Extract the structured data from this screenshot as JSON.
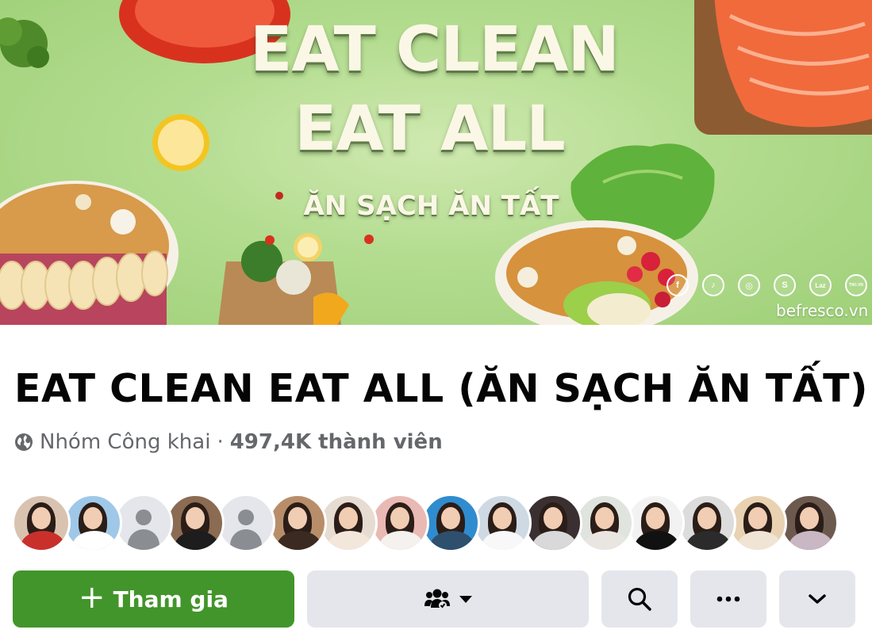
{
  "cover": {
    "title_line1": "EAT CLEAN",
    "title_line2": "EAT ALL",
    "subtitle": "ĂN SẠCH ĂN TẤT",
    "social_icons": [
      {
        "name": "facebook-icon",
        "glyph": "f"
      },
      {
        "name": "tiktok-icon",
        "glyph": "♪"
      },
      {
        "name": "instagram-icon",
        "glyph": "◎"
      },
      {
        "name": "shopee-icon",
        "glyph": "S"
      },
      {
        "name": "lazada-icon",
        "glyph": "Laz"
      },
      {
        "name": "tiki-icon",
        "glyph": "TIKI.VN"
      }
    ],
    "website": "befresco.vn"
  },
  "group": {
    "name": "EAT CLEAN EAT ALL (ĂN SẠCH ĂN TẤT)",
    "privacy": "Nhóm Công khai",
    "separator": "·",
    "members": "497,4K thành viên"
  },
  "avatars": [
    {
      "kind": "photo",
      "bg": "#d9c3b0",
      "shirt": "#c9302c"
    },
    {
      "kind": "photo",
      "bg": "#9fc8e8",
      "shirt": "#ffffff"
    },
    {
      "kind": "placeholder"
    },
    {
      "kind": "photo",
      "bg": "#8b6b52",
      "shirt": "#1d1d1d"
    },
    {
      "kind": "placeholder"
    },
    {
      "kind": "photo",
      "bg": "#b88e6a",
      "shirt": "#3b2a22"
    },
    {
      "kind": "photo",
      "bg": "#e6dcd2",
      "shirt": "#f3e7dc"
    },
    {
      "kind": "photo",
      "bg": "#e9b9b4",
      "shirt": "#f4f1ef"
    },
    {
      "kind": "photo",
      "bg": "#2f8ccf",
      "shirt": "#2e4f6e"
    },
    {
      "kind": "photo",
      "bg": "#cfd9e3",
      "shirt": "#f8f8f8"
    },
    {
      "kind": "photo",
      "bg": "#3a3032",
      "shirt": "#d9d9d9"
    },
    {
      "kind": "photo",
      "bg": "#dfe4de",
      "shirt": "#e9e6e2"
    },
    {
      "kind": "photo",
      "bg": "#f2f2f2",
      "shirt": "#111111"
    },
    {
      "kind": "photo",
      "bg": "#dcdcdc",
      "shirt": "#2b2b2b"
    },
    {
      "kind": "photo",
      "bg": "#e8d2b2",
      "shirt": "#f0e4d4"
    },
    {
      "kind": "photo",
      "bg": "#6d5a4f",
      "shirt": "#c9b7c4"
    }
  ],
  "actions": {
    "join_label": "Tham gia",
    "join_color": "#42952a",
    "join_icon": "plus-icon",
    "invite_icon": "people-group-icon",
    "invite_dropdown_icon": "caret-down-icon",
    "search_icon": "search-icon",
    "more_icon": "more-dots-icon",
    "expand_icon": "chevron-down-icon"
  }
}
